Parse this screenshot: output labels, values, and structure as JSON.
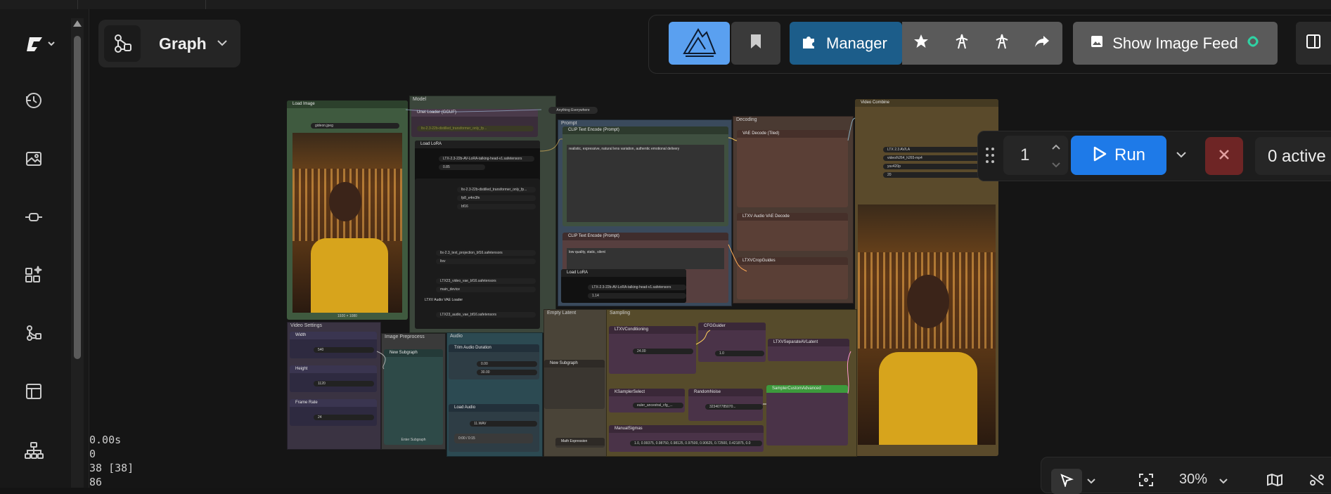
{
  "header": {
    "graph_label": "Graph",
    "manager_label": "Manager",
    "show_image_feed_label": "Show Image Feed"
  },
  "run": {
    "batch_count": "1",
    "run_label": "Run",
    "active_label": "0 active"
  },
  "stats": {
    "time": "0.00s",
    "line2": "0",
    "line3": "38 [38]",
    "line4": "86"
  },
  "zoom": {
    "value": "30%"
  },
  "groups": {
    "model": "Model",
    "prompt": "Prompt",
    "decoding": "Decoding",
    "video_settings": "Video Settings",
    "image_preprocess": "Image Preprocess",
    "audio": "Audio",
    "empty_latent": "Empty Latent",
    "sampling": "Sampling"
  },
  "nodes": {
    "load_image": {
      "title": "Load Image",
      "image": "gideon.jpeg",
      "size": "1920 × 1080"
    },
    "unet_loader": {
      "title": "Unet Loader (GGUF)",
      "badge": "Anything Everywhere"
    },
    "load_lora": {
      "title": "Load LoRA",
      "lora_name": "LTX-2.3-22b-AV-LoRA-talking-head-v1.safetensors",
      "strength": "0.85"
    },
    "model_name": "ltx-2.3-22b-distilled_transformer_only_fp...",
    "weight_dtype": "fp8_e4m3fn",
    "compute_dtype": "bf16",
    "clip_name2": "ltx-2.3_text_projection_bf16.safetensors",
    "type": "ltxv",
    "vae_name": "LTX23_video_vae_bf16.safetensors",
    "device": "main_device",
    "audio_vae_loader": "LTXV Audio VAE Loader",
    "audio_vae_ckpt": "LTX23_audio_vae_bf16.safetensors",
    "clip_pos": {
      "title": "CLIP Text Encode (Prompt)",
      "text": "realistic, expressive, natural lens variation, authentic emotional delivery"
    },
    "clip_neg": {
      "title": "CLIP Text Encode (Prompt)",
      "text": "low quality, static, silent"
    },
    "load_lora2": {
      "title": "Load LoRA",
      "lora_name": "LTX-2.3-22b-AV-LoRA-talking-head-v1.safetensors",
      "strength": "1.14"
    },
    "vae_decode": "VAE Decode (Tiled)",
    "audio_vae_decode": "LTXV Audio VAE Decode",
    "crop_guides": "LTXVCropGuides",
    "video_combine": {
      "title": "Video Combine",
      "filename": "LTX 2.3 AV/LA",
      "format": "video/h264_h265-mp4",
      "pix_fmt": "yuv420p",
      "crf": "20"
    },
    "width": {
      "title": "Width",
      "value": "540"
    },
    "height": {
      "title": "Height",
      "value": "1120"
    },
    "frame_rate": {
      "title": "Frame Rate",
      "value": "24"
    },
    "new_subgraph": "New Subgraph",
    "enter_subgraph": "Enter Subgraph",
    "trim_audio": {
      "title": "Trim Audio Duration",
      "start": "0.00",
      "duration": "30.00"
    },
    "load_audio": {
      "title": "Load Audio",
      "audio": "11.WAV",
      "time": "0:00 / 0:15"
    },
    "math_expression": "Math Expression",
    "conditioning": {
      "title": "LTXVConditioning",
      "frame_rate": "24.00"
    },
    "cfg_guider": {
      "title": "CFGGuider",
      "cfg": "1.0"
    },
    "separate": "LTXVSeparateAVLatent",
    "ksampler_select": {
      "title": "KSamplerSelect",
      "sampler": "euler_ancestral_cfg_..."
    },
    "random_noise": {
      "title": "RandomNoise",
      "seed": "323407785070..."
    },
    "sampler_custom": "SamplerCustomAdvanced",
    "manual_sigmas": {
      "title": "ManualSigmas",
      "sigmas": "1.0, 0.99375, 0.98750, 0.98125, 0.97500, 0.90625, 0.72500, 0.421875, 0.0"
    }
  },
  "colors": {
    "accent_blue": "#1e7ae8",
    "manager_blue": "#1c5d8a",
    "cancel_red": "#6e2525",
    "group_model": "#3c4a3c",
    "group_sampling": "#564b2b",
    "group_decoding": "#4a3a32",
    "group_prompt": "#3a4a5c",
    "group_audio": "#2c4a52"
  }
}
